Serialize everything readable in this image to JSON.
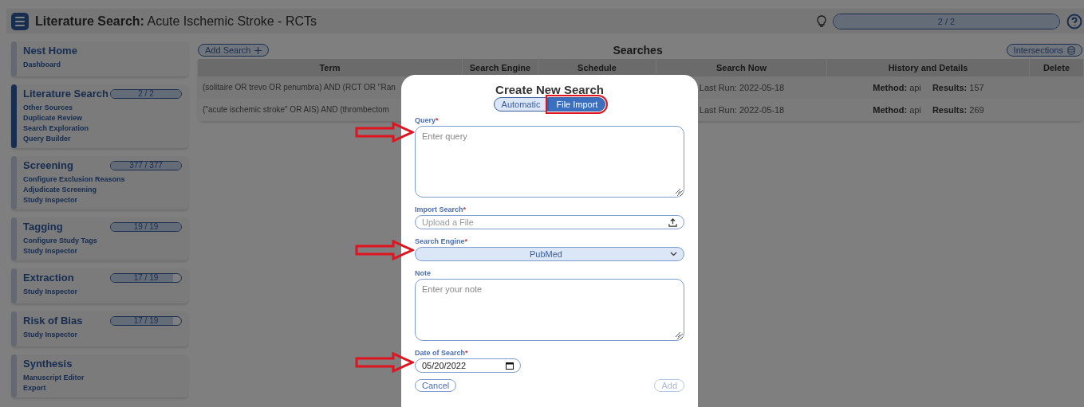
{
  "header": {
    "title_bold": "Literature Search:",
    "title": "Acute Ischemic Stroke - RCTs",
    "progress": {
      "label": "2 / 2",
      "level": 1
    }
  },
  "sidebar": [
    {
      "title": "Nest Home",
      "selected": false,
      "links": [
        "Dashboard"
      ]
    },
    {
      "title": "Literature Search",
      "selected": true,
      "progress": {
        "label": "2 / 2",
        "level": 1
      },
      "links": [
        "Other Sources",
        "Duplicate Review",
        "Search Exploration",
        "Query Builder"
      ]
    },
    {
      "title": "Screening",
      "selected": false,
      "progress": {
        "label": "377 / 377",
        "level": 1
      },
      "links": [
        "Configure Exclusion Reasons",
        "Adjudicate Screening",
        "Study Inspector"
      ]
    },
    {
      "title": "Tagging",
      "selected": false,
      "progress": {
        "label": "19 / 19",
        "level": 1
      },
      "links": [
        "Configure Study Tags",
        "Study Inspector"
      ]
    },
    {
      "title": "Extraction",
      "selected": false,
      "progress": {
        "label": "17 / 19",
        "level": 0.89
      },
      "links": [
        "Study Inspector"
      ]
    },
    {
      "title": "Risk of Bias",
      "selected": false,
      "progress": {
        "label": "17 / 19",
        "level": 0.89
      },
      "links": [
        "Study Inspector"
      ]
    },
    {
      "title": "Synthesis",
      "selected": false,
      "links": [
        "Manuscript Editor",
        "Export"
      ]
    }
  ],
  "main": {
    "add_button": "Add Search",
    "title": "Searches",
    "intersections_button": "Intersections",
    "table": {
      "columns": [
        "Term",
        "Search Engine",
        "Schedule",
        "Search Now",
        "History and Details",
        "Delete"
      ],
      "rows": [
        {
          "term": "(solitaire OR trevo OR penumbra) AND (RCT OR \"Ran",
          "search_now": "Last Run: 2022-05-18",
          "method_label": "Method:",
          "method": "api",
          "results_label": "Results:",
          "results": "157"
        },
        {
          "term": "(\"acute ischemic stroke\" OR AIS) AND (thrombectom",
          "search_now": "Last Run: 2022-05-18",
          "method_label": "Method:",
          "method": "api",
          "results_label": "Results:",
          "results": "269"
        }
      ]
    }
  },
  "modal": {
    "title": "Create New Search",
    "modes": [
      {
        "label": "Automatic",
        "selected": false,
        "highlighted": false
      },
      {
        "label": "File Import",
        "selected": true,
        "highlighted": true
      }
    ],
    "fields": [
      {
        "kind": "textarea",
        "label": "Query",
        "required_mark": "*",
        "placeholder": "Enter query",
        "annotated": true
      },
      {
        "kind": "file",
        "label": "Import Search",
        "required_mark": "*",
        "placeholder": "Upload a File",
        "annotated": false
      },
      {
        "kind": "select",
        "label": "Search Engine",
        "required_mark": "*",
        "value": "PubMed",
        "annotated": true
      },
      {
        "kind": "textarea",
        "label": "Note",
        "placeholder": "Enter your note",
        "annotated": false
      },
      {
        "kind": "date",
        "label": "Date of Search",
        "required_mark": "*",
        "value": "05/20/2022",
        "annotated": true
      }
    ],
    "buttons": [
      {
        "label": "Cancel",
        "disabled": false
      },
      {
        "label": "Add",
        "disabled": true
      }
    ]
  }
}
